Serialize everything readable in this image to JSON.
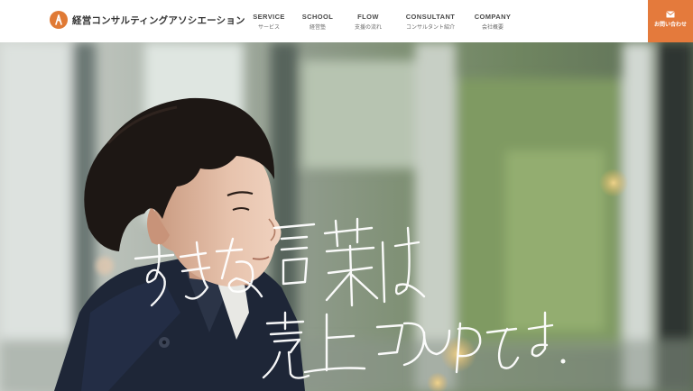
{
  "brand": {
    "name": "経営コンサルティングアソシエーション",
    "accent_color": "#e47a3c"
  },
  "nav": {
    "items": [
      {
        "en": "SERVICE",
        "ja": "サービス"
      },
      {
        "en": "SCHOOL",
        "ja": "経営塾"
      },
      {
        "en": "FLOW",
        "ja": "支援の流れ"
      },
      {
        "en": "CONSULTANT",
        "ja": "コンサルタント紹介"
      },
      {
        "en": "COMPANY",
        "ja": "会社概要"
      }
    ]
  },
  "contact": {
    "label": "お問い合わせ",
    "icon": "mail-icon"
  },
  "hero": {
    "headline_line1": "すきな言葉は",
    "headline_line2": "売上2倍UPです。",
    "image": "young man in navy coat looking right, blurred green background"
  }
}
